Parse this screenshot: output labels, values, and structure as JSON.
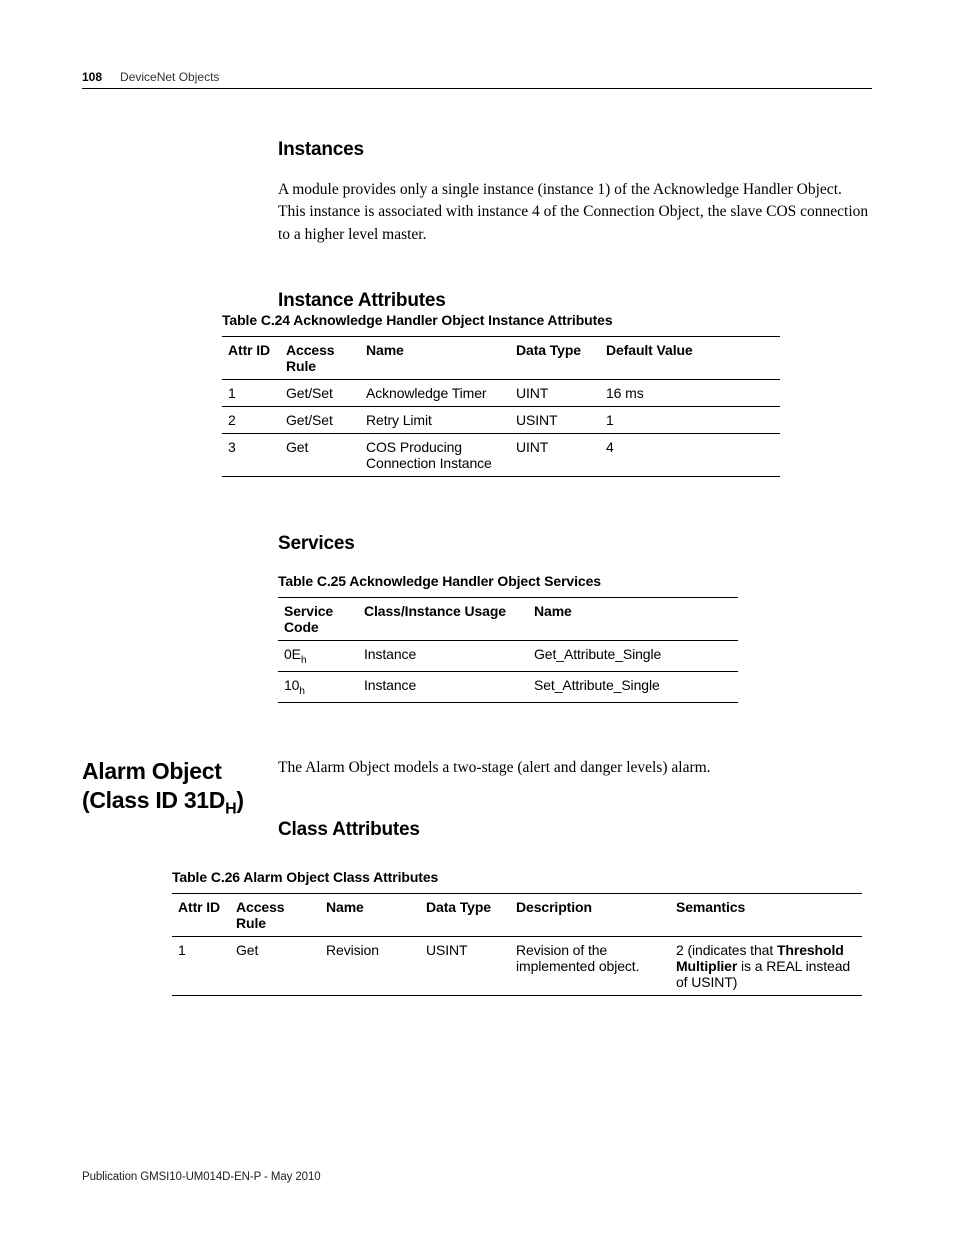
{
  "header": {
    "page_number": "108",
    "chapter": "DeviceNet Objects"
  },
  "instances": {
    "heading": "Instances",
    "body": "A module provides only a single instance (instance 1) of the Acknowledge Handler Object. This instance is associated with instance 4 of the Connection Object, the slave COS connection to a higher level master."
  },
  "instance_attributes": {
    "heading": "Instance Attributes",
    "caption": "Table C.24 Acknowledge Handler Object Instance Attributes",
    "headers": {
      "attr_id": "Attr ID",
      "access": "Access Rule",
      "name": "Name",
      "dtype": "Data Type",
      "default": "Default Value"
    },
    "rows": [
      {
        "id": "1",
        "access": "Get/Set",
        "name": "Acknowledge Timer",
        "dtype": "UINT",
        "default": "16 ms"
      },
      {
        "id": "2",
        "access": "Get/Set",
        "name": "Retry Limit",
        "dtype": "USINT",
        "default": "1"
      },
      {
        "id": "3",
        "access": "Get",
        "name": "COS Producing Connection Instance",
        "dtype": "UINT",
        "default": "4"
      }
    ]
  },
  "services": {
    "heading": "Services",
    "caption": "Table C.25 Acknowledge Handler Object Services",
    "headers": {
      "code": "Service Code",
      "usage": "Class/Instance Usage",
      "name": "Name"
    },
    "rows": [
      {
        "code_base": "0E",
        "code_sub": "h",
        "usage": "Instance",
        "name": "Get_Attribute_Single"
      },
      {
        "code_base": "10",
        "code_sub": "h",
        "usage": "Instance",
        "name": "Set_Attribute_Single"
      }
    ]
  },
  "alarm": {
    "side_line1": "Alarm Object",
    "side_line2_pre": "(Class ID 31D",
    "side_line2_sub": "H",
    "side_line2_post": ")",
    "intro": "The Alarm Object models a two-stage (alert and danger levels) alarm.",
    "class_heading": "Class Attributes",
    "caption": "Table C.26 Alarm Object Class Attributes",
    "headers": {
      "attr_id": "Attr ID",
      "access": "Access Rule",
      "name": "Name",
      "dtype": "Data Type",
      "desc": "Description",
      "sem": "Semantics"
    },
    "rows": [
      {
        "id": "1",
        "access": "Get",
        "name": "Revision",
        "dtype": "USINT",
        "desc": "Revision of the implemented object.",
        "sem_pre": "2 (indicates that ",
        "sem_bold": "Threshold Multiplier",
        "sem_post": " is a REAL instead of USINT)"
      }
    ]
  },
  "footer": "Publication GMSI10-UM014D-EN-P - May 2010"
}
